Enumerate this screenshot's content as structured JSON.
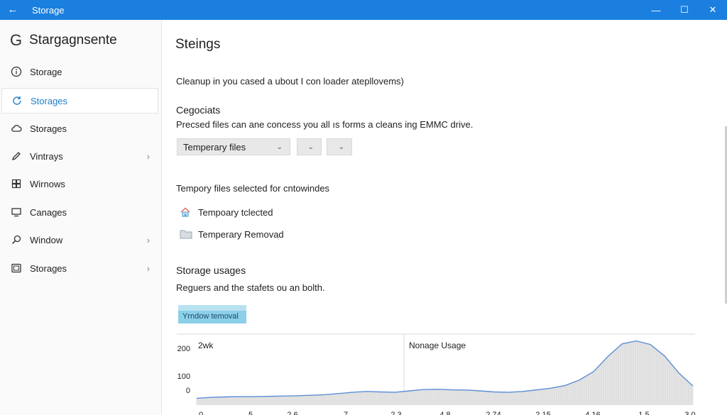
{
  "window": {
    "title": "Storage",
    "back_glyph": "←",
    "minimize_glyph": "—",
    "maximize_glyph": "☐",
    "close_glyph": "✕"
  },
  "sidebar": {
    "app_letter": "G",
    "app_title": "Stargagnsente",
    "items": [
      {
        "label": "Storage",
        "icon": "info-icon",
        "chevron": false,
        "selected": false
      },
      {
        "label": "Storages",
        "icon": "refresh-icon",
        "chevron": false,
        "selected": true
      },
      {
        "label": "Storages",
        "icon": "cloud-icon",
        "chevron": false,
        "selected": false
      },
      {
        "label": "Vintrays",
        "icon": "pen-icon",
        "chevron": true,
        "selected": false
      },
      {
        "label": "Wirnows",
        "icon": "apps-icon",
        "chevron": false,
        "selected": false
      },
      {
        "label": "Canages",
        "icon": "monitor-icon",
        "chevron": false,
        "selected": false
      },
      {
        "label": "Window",
        "icon": "search-icon",
        "chevron": true,
        "selected": false
      },
      {
        "label": "Storages",
        "icon": "tablet-icon",
        "chevron": true,
        "selected": false
      }
    ],
    "chevron_glyph": "›"
  },
  "main": {
    "heading": "Steings",
    "intro": "Cleanup in you cased a ubout I con loader atepllovems)",
    "section1_title": "Cegociats",
    "section1_desc": "Precsed files can ane concess you all ıs forms a cleans ing EMMC drive.",
    "dropdowns": [
      {
        "label": "Temperary files"
      },
      {
        "label": ""
      },
      {
        "label": ""
      }
    ],
    "selected_text": "Tempory files selected for cntowindes",
    "files": [
      {
        "label": "Tempoary tclected",
        "icon": "home-icon"
      },
      {
        "label": "Temperary Removad",
        "icon": "folder-icon"
      }
    ],
    "section2_title": "Storage usages",
    "section2_desc": "Reguers and the stafets ou an bolth.",
    "legend_label": "Yrndow temoval"
  },
  "chart_data": {
    "type": "area",
    "label_left": "2wk",
    "label_mid": "Nonage Usage",
    "y_ticks": [
      "200",
      "100",
      "0"
    ],
    "x_ticks": [
      "0",
      "5",
      "2 6",
      "7",
      "2 3",
      "4 8",
      "2 74",
      "2 15",
      "4 16",
      "1.5",
      "3.0"
    ],
    "ylim": [
      0,
      260
    ],
    "values": [
      25,
      28,
      30,
      31,
      31,
      32,
      33,
      34,
      36,
      38,
      42,
      47,
      50,
      48,
      47,
      52,
      57,
      58,
      56,
      55,
      52,
      48,
      47,
      50,
      56,
      62,
      72,
      92,
      123,
      178,
      224,
      235,
      222,
      180,
      118,
      70
    ],
    "line_color": "#5b8fd6",
    "fill_color": "#e6e6e6"
  }
}
